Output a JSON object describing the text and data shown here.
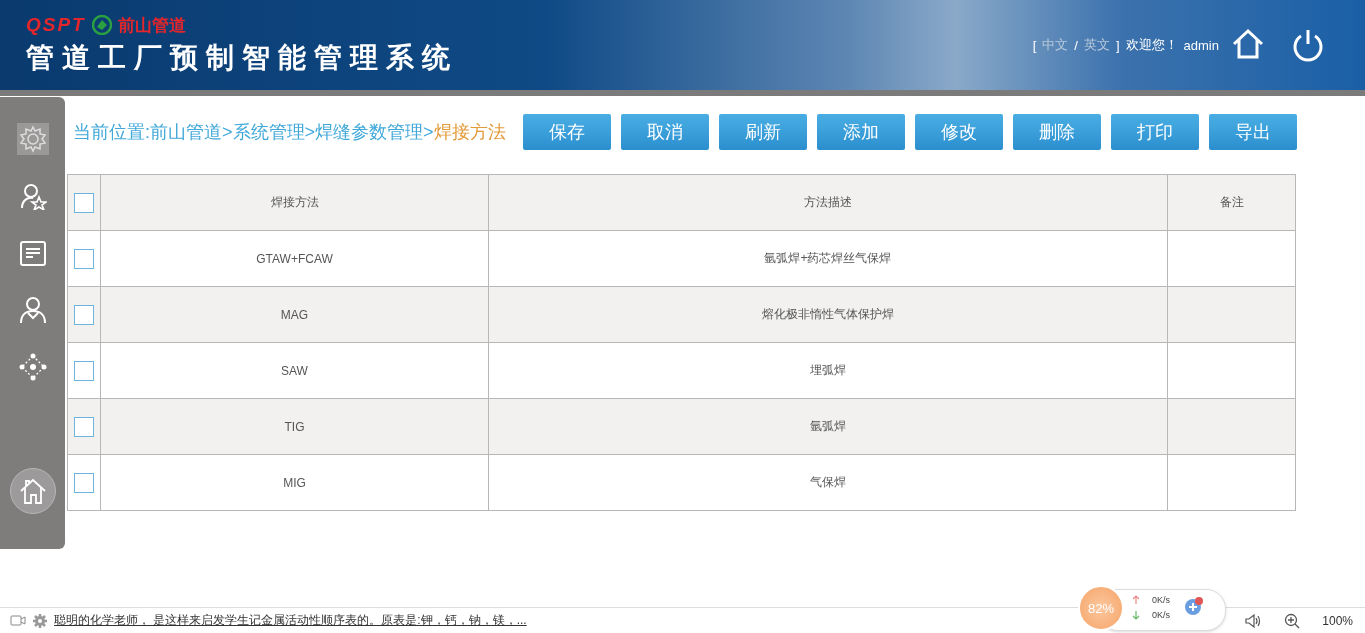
{
  "header": {
    "brand_code": "QSPT",
    "brand_name": "前山管道",
    "title": "管道工厂预制智能管理系统",
    "lang_open": "[",
    "languages": [
      "中文",
      "英文"
    ],
    "lang_sep": "/",
    "lang_close": "]",
    "welcome": "欢迎您！",
    "user": "admin"
  },
  "sidebar": {
    "items": [
      {
        "kind": "gear",
        "selected": true
      },
      {
        "kind": "user-star",
        "selected": false
      },
      {
        "kind": "document",
        "selected": false
      },
      {
        "kind": "user",
        "selected": false
      },
      {
        "kind": "network",
        "selected": false
      }
    ]
  },
  "breadcrumb": {
    "trail": "当前位置:前山管道>系统管理>焊缝参数管理>",
    "current": "焊接方法"
  },
  "toolbar": [
    "保存",
    "取消",
    "刷新",
    "添加",
    "修改",
    "删除",
    "打印",
    "导出"
  ],
  "table": {
    "all_checked": false,
    "columns": [
      "焊接方法",
      "方法描述",
      "备注"
    ],
    "rows": [
      {
        "checked": false,
        "method": "GTAW+FCAW",
        "description": "氩弧焊+药芯焊丝气保焊"
      },
      {
        "checked": false,
        "method": "MAG",
        "description": "熔化极非惰性气体保护焊"
      },
      {
        "checked": false,
        "method": "SAW",
        "description": "埋弧焊"
      },
      {
        "checked": false,
        "method": "TIG",
        "description": "氩弧焊"
      },
      {
        "checked": false,
        "method": "MIG",
        "description": "气保焊"
      }
    ]
  },
  "monitor": {
    "memory": "82%",
    "upload": "0K/s",
    "download": "0K/s"
  },
  "status_bar": {
    "news": "聪明的化学老师， 是这样来启发学生记金属活动性顺序表的。原表是:钾，钙，钠，镁，...",
    "zoom": "100%"
  }
}
